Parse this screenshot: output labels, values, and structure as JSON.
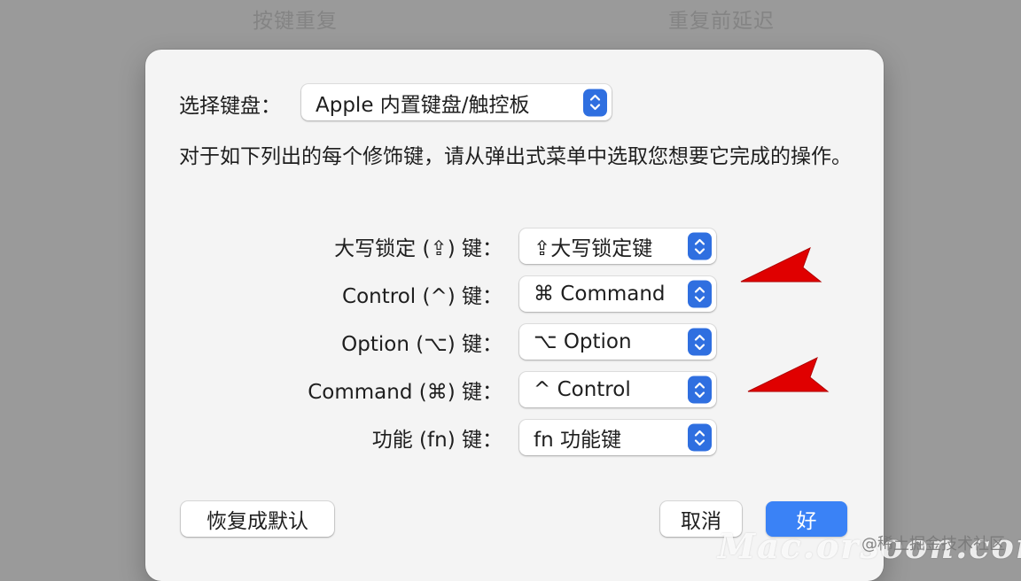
{
  "background": {
    "left_label": "按键重复",
    "right_label": "重复前延迟"
  },
  "dialog": {
    "keyboard_label": "选择键盘：",
    "keyboard_value": "Apple 内置键盘/触控板",
    "description": "对于如下列出的每个修饰键，请从弹出式菜单中选取您想要它完成的操作。",
    "modifiers": [
      {
        "label": "大写锁定 (⇪) 键：",
        "value": "⇪大写锁定键"
      },
      {
        "label": "Control (^) 键：",
        "value": "⌘ Command"
      },
      {
        "label": "Option (⌥) 键：",
        "value": "⌥ Option"
      },
      {
        "label": "Command (⌘) 键：",
        "value": "^ Control"
      },
      {
        "label": "功能 (fn) 键：",
        "value": "fn 功能键"
      }
    ],
    "restore_defaults_label": "恢复成默认",
    "cancel_label": "取消",
    "ok_label": "好"
  },
  "watermark": "Mac.orsoon.com",
  "credit": "@稀土掘金技术社区",
  "colors": {
    "accent": "#3a82f6",
    "arrow": "#e00000"
  }
}
